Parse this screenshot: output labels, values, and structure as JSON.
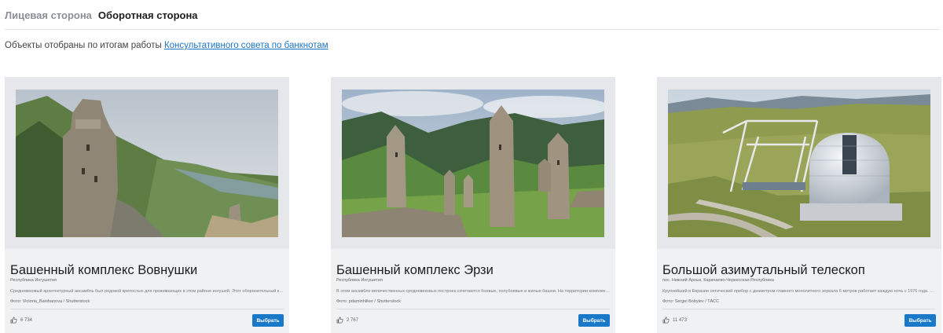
{
  "tabs": [
    {
      "label": "Лицевая сторона",
      "active": false
    },
    {
      "label": "Оборотная сторона",
      "active": true
    }
  ],
  "intro": {
    "text": "Объекты отобраны по итогам работы ",
    "link": "Консультативного совета по банкнотам"
  },
  "cards": [
    {
      "title": "Башенный комплекс Вовнушки",
      "region": "Республика Ингушетия",
      "description": "Средневековый архитектурный ансамбль был родовой крепостью для проживающих в этом районе ингушей. Этот оборонительный комплекс ...",
      "credit": "Фото: Victoria_Baiobanova / Shutterstock",
      "likes": "6 734",
      "button_label": "Выбрать"
    },
    {
      "title": "Башенный комплекс Эрзи",
      "region": "Республика Ингушетия",
      "description": "В этом ансамбле величественных средневековых построек сочетаются боевые, полубоевые и жилые башни. На территории комплекса сохра...",
      "credit": "Фото: pdaminhliker / Shutterstock",
      "likes": "2 767",
      "button_label": "Выбрать"
    },
    {
      "title": "Большой азимутальный телескоп",
      "region": "пос. Нижний Архыз, Карачаево-Черкесская Республика",
      "description": "Крупнейший в Евразии оптический прибор с диаметром главного монолитного зеркала 6 метров работает каждую ночь с 1976 года. Его время...",
      "credit": "Фото: Sergei Bobylev / ТАСС",
      "likes": "11 473",
      "button_label": "Выбрать"
    }
  ]
}
